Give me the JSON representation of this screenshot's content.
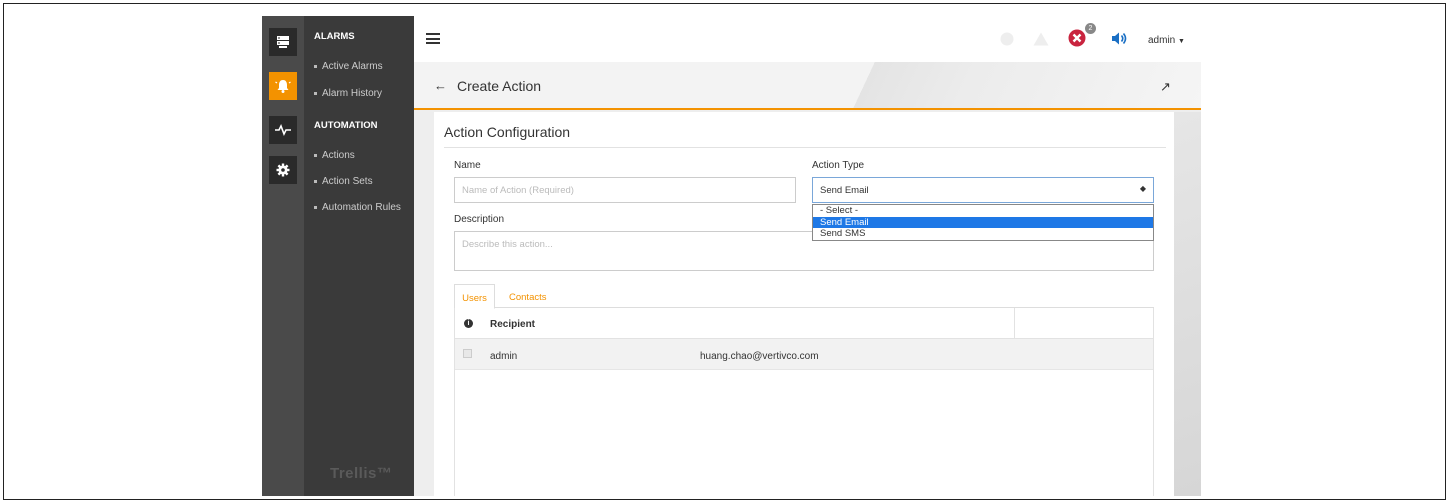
{
  "nav": {
    "sections": [
      {
        "label": "ALARMS",
        "items": [
          "Active Alarms",
          "Alarm History"
        ]
      },
      {
        "label": "AUTOMATION",
        "items": [
          "Actions",
          "Action Sets",
          "Automation Rules"
        ]
      }
    ],
    "brand": "Trellis™"
  },
  "rail_icons": [
    "server-icon",
    "alarm-bell-icon",
    "pulse-icon",
    "gear-icon"
  ],
  "topbar": {
    "notification_count": "2",
    "user": "admin"
  },
  "page": {
    "title": "Create Action"
  },
  "form": {
    "heading": "Action Configuration",
    "name_label": "Name",
    "name_placeholder": "Name of Action (Required)",
    "name_value": "",
    "action_type_label": "Action Type",
    "action_type_value": "Send Email",
    "action_type_options": [
      "- Select -",
      "Send Email",
      "Send SMS"
    ],
    "description_label": "Description",
    "description_placeholder": "Describe this action..."
  },
  "tabs": [
    "Users",
    "Contacts"
  ],
  "table": {
    "header": "Recipient",
    "rows": [
      {
        "name": "admin",
        "email": "huang.chao@vertivco.com"
      }
    ]
  },
  "colors": {
    "accent": "#f39200",
    "selected_option": "#1e78e6",
    "error": "#c9243f",
    "sound": "#1a6fc4"
  }
}
